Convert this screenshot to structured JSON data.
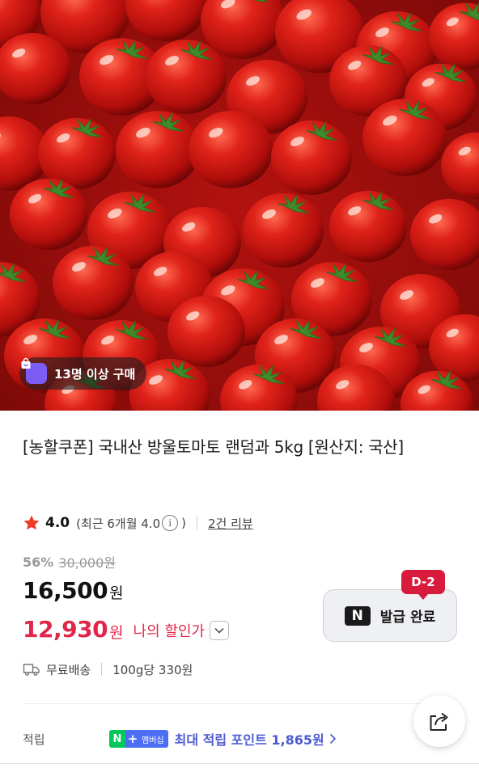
{
  "hero": {
    "image_subject": "cherry tomatoes",
    "buyers_badge": "13명 이상 구매",
    "badge_icon": "shopping-bag-icon"
  },
  "product": {
    "title": "[농할쿠폰] 국내산 방울토마토 랜덤과 5kg [원산지: 국산]"
  },
  "rating": {
    "score": "4.0",
    "recent_prefix": "(최근 6개월 4.0",
    "recent_suffix": ")",
    "reviews_link": "2건 리뷰"
  },
  "pricing": {
    "discount_percent": "56%",
    "original_price": "30,000원",
    "price_value": "16,500",
    "price_unit": "원",
    "my_price_value": "12,930",
    "my_price_unit": "원",
    "my_price_label": "나의 할인가"
  },
  "coupon": {
    "logo": "N",
    "label": "발급 완료",
    "dday": "D-2"
  },
  "shipping": {
    "label": "무료배송",
    "unit_price": "100g당 330원"
  },
  "points": {
    "label": "적립",
    "badge_n": "N",
    "badge_plus": "+",
    "badge_member": "멤버십",
    "text": "최대 적립 포인트 1,865원"
  },
  "colors": {
    "accent_red": "#e0264a",
    "dday_red": "#d81b3c",
    "naver_green": "#03c75a",
    "membership_blue": "#4c6ef5",
    "points_text": "#4c5bd4",
    "badge_purple": "#7b5cf5"
  }
}
